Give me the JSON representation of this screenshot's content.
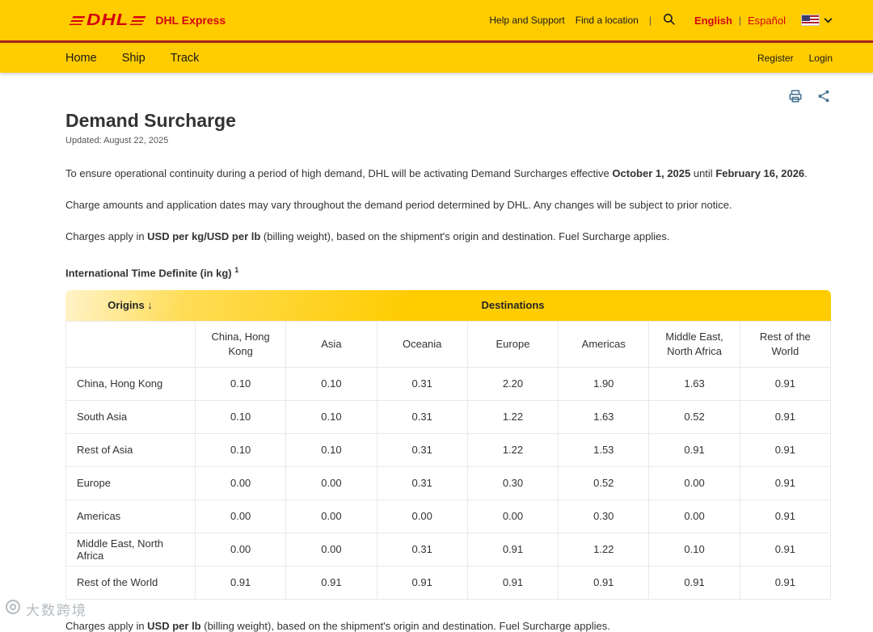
{
  "colors": {
    "brand_yellow": "#FFCC00",
    "brand_red": "#D40511"
  },
  "header": {
    "brand": "DHL",
    "brand_name": "DHL Express",
    "help_link": "Help and Support",
    "location_link": "Find a location",
    "divider": "|",
    "lang_primary": "English",
    "lang_secondary": "Español"
  },
  "nav": {
    "home": "Home",
    "ship": "Ship",
    "track": "Track",
    "register": "Register",
    "login": "Login"
  },
  "page": {
    "title": "Demand Surcharge",
    "updated": "Updated: August 22, 2025",
    "intro": {
      "pre": "To ensure operational continuity during a period of high demand, DHL will be activating Demand Surcharges effective ",
      "bold_start": "October 1, 2025",
      "mid": " until ",
      "bold_end": "February 16, 2026",
      "post": "."
    },
    "notice": "Charge amounts and application dates may vary throughout the demand period determined by DHL. Any changes will be subject to prior notice.",
    "charges": {
      "pre": "Charges apply in ",
      "bold": "USD per kg/USD per lb",
      "post": " (billing weight), based on the shipment's origin and destination. Fuel Surcharge applies."
    },
    "table_heading": "International Time Definite (in kg)",
    "table_heading_sup": "1",
    "footer": {
      "pre": "Charges apply in ",
      "bold": "USD per lb",
      "post": " (billing weight), based on the shipment's origin and destination. Fuel Surcharge applies."
    }
  },
  "chart_data": {
    "type": "table",
    "origins_label": "Origins ↓",
    "destinations_label": "Destinations",
    "columns": [
      "China, Hong Kong",
      "Asia",
      "Oceania",
      "Europe",
      "Americas",
      "Middle East, North Africa",
      "Rest of the World"
    ],
    "rows": [
      {
        "origin": "China, Hong Kong",
        "values": [
          "0.10",
          "0.10",
          "0.31",
          "2.20",
          "1.90",
          "1.63",
          "0.91"
        ]
      },
      {
        "origin": "South Asia",
        "values": [
          "0.10",
          "0.10",
          "0.31",
          "1.22",
          "1.63",
          "0.52",
          "0.91"
        ]
      },
      {
        "origin": "Rest of Asia",
        "values": [
          "0.10",
          "0.10",
          "0.31",
          "1.22",
          "1.53",
          "0.91",
          "0.91"
        ]
      },
      {
        "origin": "Europe",
        "values": [
          "0.00",
          "0.00",
          "0.31",
          "0.30",
          "0.52",
          "0.00",
          "0.91"
        ]
      },
      {
        "origin": "Americas",
        "values": [
          "0.00",
          "0.00",
          "0.00",
          "0.00",
          "0.30",
          "0.00",
          "0.91"
        ]
      },
      {
        "origin": "Middle East, North Africa",
        "values": [
          "0.00",
          "0.00",
          "0.31",
          "0.91",
          "1.22",
          "0.10",
          "0.91"
        ]
      },
      {
        "origin": "Rest of the World",
        "values": [
          "0.91",
          "0.91",
          "0.91",
          "0.91",
          "0.91",
          "0.91",
          "0.91"
        ]
      }
    ]
  },
  "watermark": {
    "text": "大数跨境"
  }
}
